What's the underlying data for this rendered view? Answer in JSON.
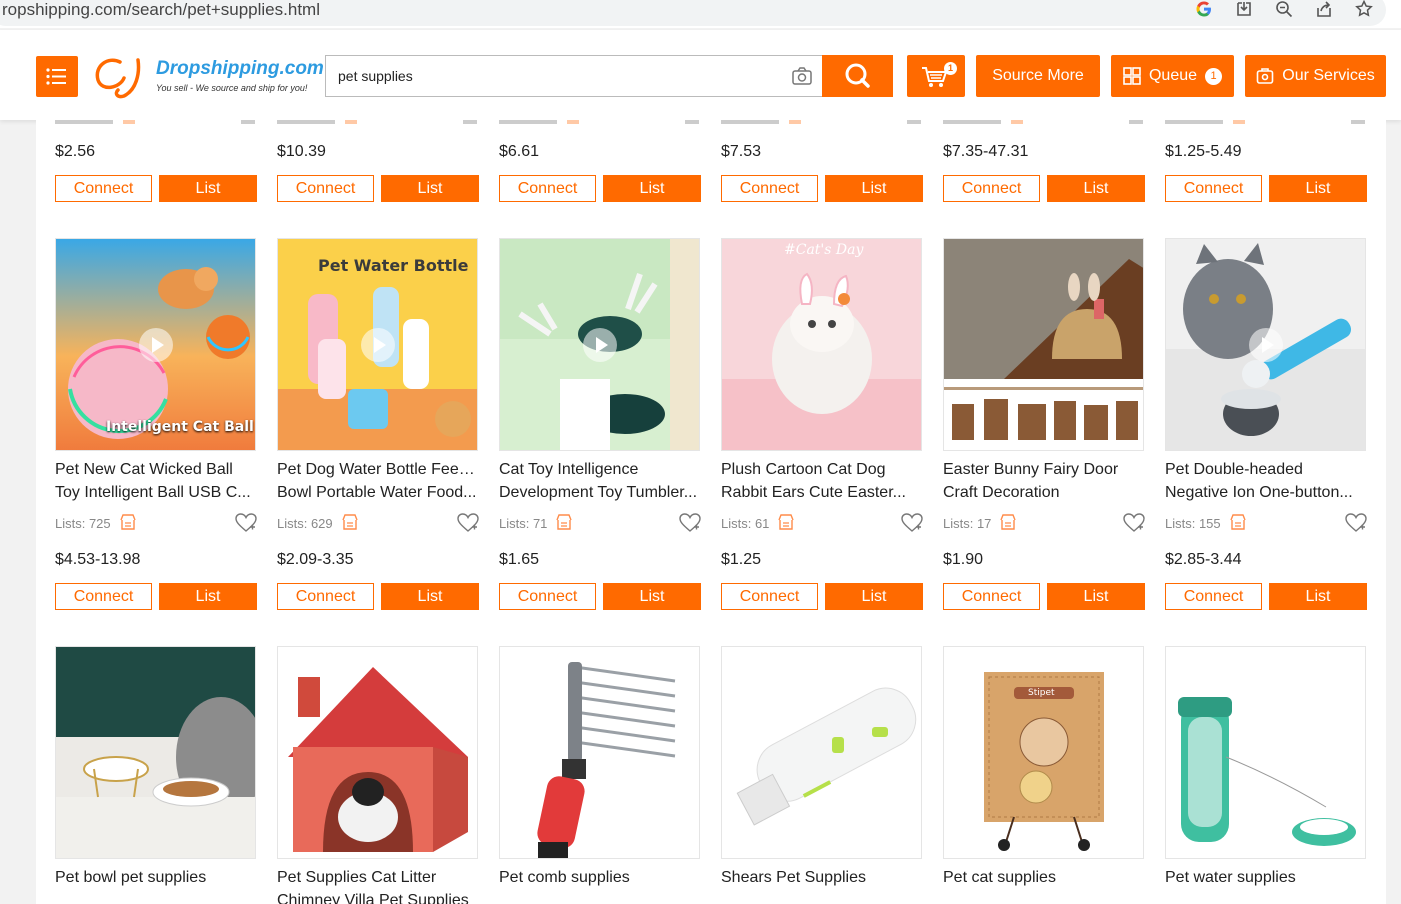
{
  "browser": {
    "url": "ropshipping.com/search/pet+supplies.html"
  },
  "header": {
    "logo_brand": "Dropshipping.com",
    "logo_tagline": "You sell - We source and ship for you!",
    "search_value": "pet supplies",
    "cart_count": "1",
    "source_more": "Source More",
    "queue_label": "Queue",
    "queue_count": "1",
    "our_services": "Our Services",
    "accent_color": "#ff6a00"
  },
  "partial_row": [
    {
      "price": "$2.56",
      "connect": "Connect",
      "list": "List"
    },
    {
      "price": "$10.39",
      "connect": "Connect",
      "list": "List"
    },
    {
      "price": "$6.61",
      "connect": "Connect",
      "list": "List"
    },
    {
      "price": "$7.53",
      "connect": "Connect",
      "list": "List"
    },
    {
      "price": "$7.35-47.31",
      "connect": "Connect",
      "list": "List"
    },
    {
      "price": "$1.25-5.49",
      "connect": "Connect",
      "list": "List"
    }
  ],
  "products": [
    {
      "title1": "Pet New Cat Wicked Ball",
      "title2": "Toy Intelligent Ball USB C...",
      "lists": "Lists: 725",
      "price": "$4.53-13.98",
      "connect": "Connect",
      "list": "List",
      "image_text": "Intelligent Cat Ball",
      "video": true
    },
    {
      "title1": "Pet Dog Water Bottle Feeder",
      "title2": "Bowl Portable Water Food...",
      "lists": "Lists: 629",
      "price": "$2.09-3.35",
      "connect": "Connect",
      "list": "List",
      "image_text": "Pet Water Bottle",
      "video": true
    },
    {
      "title1": "Cat Toy Intelligence",
      "title2": "Development Toy Tumbler...",
      "lists": "Lists: 71",
      "price": "$1.65",
      "connect": "Connect",
      "list": "List",
      "image_text": "",
      "video": true
    },
    {
      "title1": "Plush Cartoon Cat Dog",
      "title2": "Rabbit Ears Cute Easter...",
      "lists": "Lists: 61",
      "price": "$1.25",
      "connect": "Connect",
      "list": "List",
      "image_text": "#Cat's Day",
      "video": false
    },
    {
      "title1": "Easter Bunny Fairy Door",
      "title2": "Craft Decoration",
      "lists": "Lists: 17",
      "price": "$1.90",
      "connect": "Connect",
      "list": "List",
      "image_text": "",
      "video": false
    },
    {
      "title1": "Pet Double-headed",
      "title2": "Negative Ion One-button...",
      "lists": "Lists: 155",
      "price": "$2.85-3.44",
      "connect": "Connect",
      "list": "List",
      "image_text": "",
      "video": true
    }
  ],
  "bottom_row": [
    {
      "title1": "Pet bowl pet supplies",
      "title2": ""
    },
    {
      "title1": "Pet Supplies Cat Litter",
      "title2": "Chimney Villa Pet Supplies"
    },
    {
      "title1": "Pet comb supplies",
      "title2": ""
    },
    {
      "title1": "Shears Pet Supplies",
      "title2": ""
    },
    {
      "title1": "Pet cat supplies",
      "title2": "",
      "image_text": "Stipet"
    },
    {
      "title1": "Pet water supplies",
      "title2": ""
    }
  ]
}
